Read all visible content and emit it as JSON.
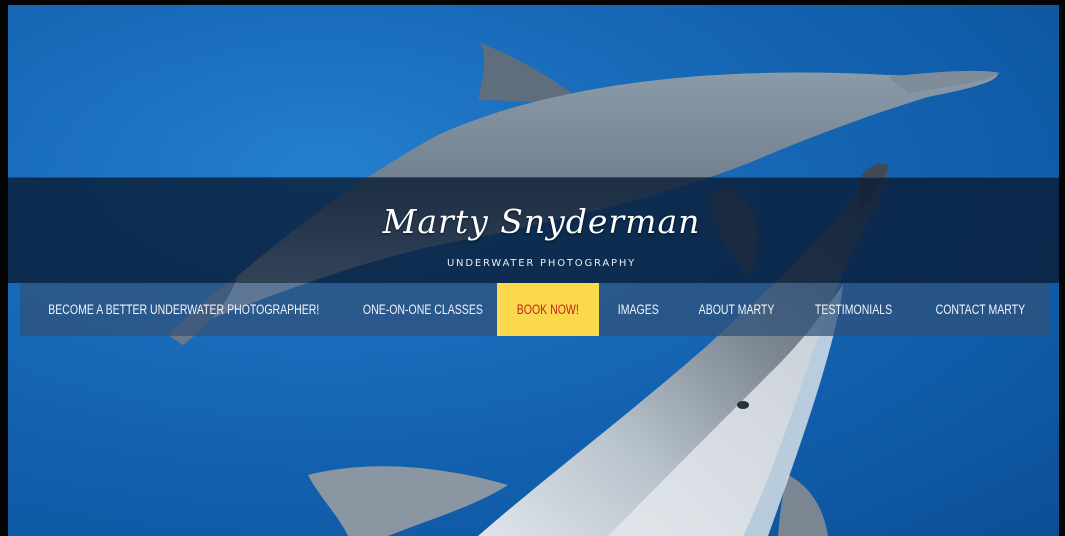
{
  "site": {
    "name": "Marty Snyderman",
    "tagline": "UNDERWATER PHOTOGRAPHY"
  },
  "nav": {
    "items": [
      {
        "label": "BECOME A BETTER UNDERWATER PHOTOGRAPHER!",
        "active": false
      },
      {
        "label": "ONE-ON-ONE CLASSES",
        "active": false
      },
      {
        "label": "BOOK NOW!",
        "active": true
      },
      {
        "label": "IMAGES",
        "active": false
      },
      {
        "label": "ABOUT MARTY",
        "active": false
      },
      {
        "label": "TESTIMONIALS",
        "active": false
      },
      {
        "label": "CONTACT MARTY",
        "active": false
      }
    ]
  },
  "colors": {
    "ocean": "#1568b8",
    "band": "#0a1c34",
    "active_bg": "#fbd84c",
    "active_text": "#c4241c"
  }
}
